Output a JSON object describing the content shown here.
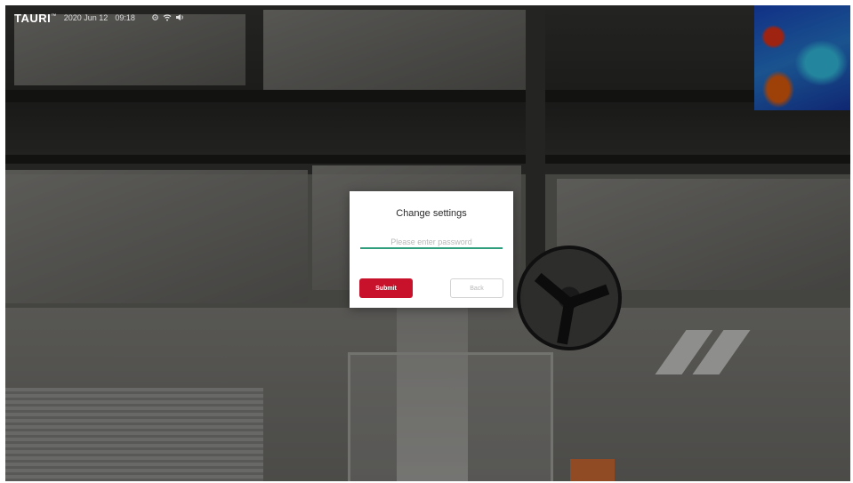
{
  "statusbar": {
    "brand": "TAURI",
    "trademark": "™",
    "date": "2020 Jun 12",
    "time": "09:18",
    "icons": [
      "settings-icon",
      "wifi-icon",
      "volume-icon"
    ]
  },
  "dialog": {
    "title": "Change settings",
    "password_placeholder": "Please enter password",
    "password_value": "",
    "submit_label": "Submit",
    "back_label": "Back"
  },
  "colors": {
    "submit": "#c8112b",
    "input_underline": "#2f9e7d"
  }
}
